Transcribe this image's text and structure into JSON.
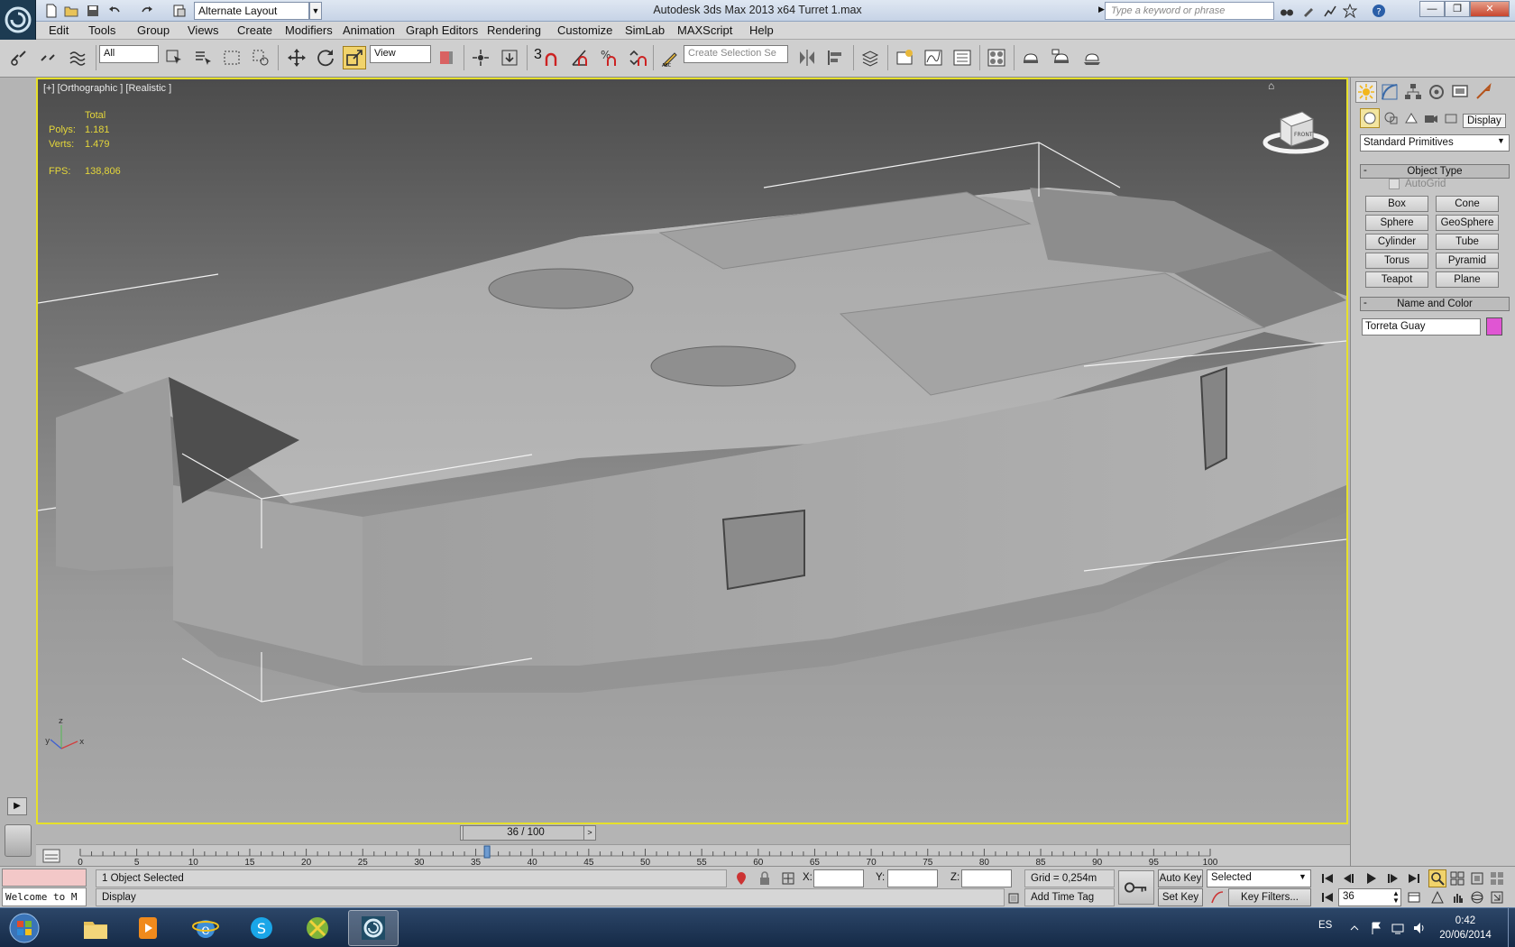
{
  "app": {
    "window_title": "Autodesk 3ds Max  2013 x64      Turret 1.max",
    "workspace": "Alternate Layout",
    "search_placeholder": "Type a keyword or phrase"
  },
  "menu": [
    "Edit",
    "Tools",
    "Group",
    "Views",
    "Create",
    "Modifiers",
    "Animation",
    "Graph Editors",
    "Rendering",
    "Customize",
    "SimLab",
    "MAXScript",
    "Help"
  ],
  "toolbar": {
    "selection_filter": "All",
    "reference_coord": "View",
    "snap_number": "3",
    "selection_set_placeholder": "Create Selection Se"
  },
  "viewport": {
    "label": "[+] [Orthographic ] [Realistic ]",
    "stats": {
      "total_label": "Total",
      "polys_label": "Polys:",
      "polys_value": "1.181",
      "verts_label": "Verts:",
      "verts_value": "1.479",
      "fps_label": "FPS:",
      "fps_value": "138,806"
    },
    "axis": {
      "z": "z",
      "y": "y",
      "x": "x"
    },
    "viewcube_face": "FRONT"
  },
  "command_panel": {
    "tooltip": "Display",
    "category": "Standard Primitives",
    "object_type_title": "Object Type",
    "autogrid_label": "AutoGrid",
    "primitives": [
      "Box",
      "Cone",
      "Sphere",
      "GeoSphere",
      "Cylinder",
      "Tube",
      "Torus",
      "Pyramid",
      "Teapot",
      "Plane"
    ],
    "name_color_title": "Name and Color",
    "object_name": "Torreta Guay",
    "object_color": "#e055d3"
  },
  "timeline": {
    "frame_display": "36 / 100",
    "current_frame": 36,
    "total_frames": 100,
    "ticks": [
      "0",
      "5",
      "10",
      "15",
      "20",
      "25",
      "30",
      "35",
      "40",
      "45",
      "50",
      "55",
      "60",
      "65",
      "70",
      "75",
      "80",
      "85",
      "90",
      "95",
      "100"
    ]
  },
  "status": {
    "maxscript_listener": "Welcome to M",
    "selection_info": "1 Object Selected",
    "prompt": "Display",
    "x_label": "X:",
    "y_label": "Y:",
    "z_label": "Z:",
    "grid": "Grid = 0,254m",
    "add_time_tag": "Add Time Tag",
    "auto_key": "Auto Key",
    "set_key": "Set Key",
    "key_mode": "Selected",
    "key_filters": "Key Filters...",
    "frame_field": "36"
  },
  "taskbar": {
    "language": "ES",
    "time": "0:42",
    "date": "20/06/2014"
  },
  "colors": {
    "viewport_border": "#e6e02a",
    "stats_text": "#e4d63a"
  }
}
